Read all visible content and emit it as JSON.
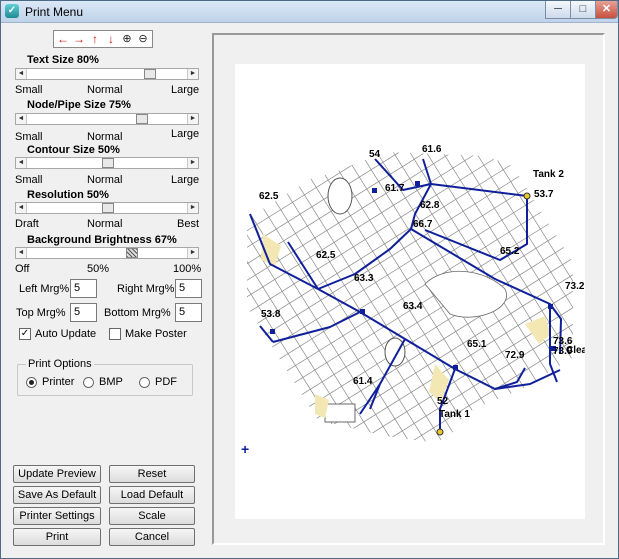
{
  "window": {
    "title": "Print Menu",
    "controls": {
      "minimize": "─",
      "maximize": "□",
      "close": "✕"
    }
  },
  "toolbar": {
    "icons": [
      "arrow-left-icon",
      "arrow-right-icon",
      "arrow-up-icon",
      "arrow-down-icon",
      "zoom-in-icon",
      "zoom-out-icon"
    ]
  },
  "text_size": {
    "label": "Text Size 80%",
    "min": "Small",
    "mid": "Normal",
    "max": "Large",
    "value": 0.8
  },
  "node_size": {
    "label": "Node/Pipe Size 75%",
    "min": "Small",
    "mid": "Normal",
    "max": "Large",
    "value": 0.75
  },
  "contour_size": {
    "label": "Contour Size 50%",
    "min": "Small",
    "mid": "Normal",
    "max": "Large",
    "value": 0.5
  },
  "resolution": {
    "label": "Resolution 50%",
    "min": "Draft",
    "mid": "Normal",
    "max": "Best",
    "value": 0.5
  },
  "background": {
    "label": "Background Brightness 67%",
    "min": "Off",
    "mid": "50%",
    "max": "100%",
    "value": 0.67
  },
  "margins": {
    "left_label": "Left Mrg%",
    "left_value": "5",
    "right_label": "Right Mrg%",
    "right_value": "5",
    "top_label": "Top Mrg%",
    "top_value": "5",
    "bottom_label": "Bottom Mrg%",
    "bottom_value": "5"
  },
  "checks": {
    "auto_update": "Auto Update",
    "auto_update_checked": true,
    "make_poster": "Make Poster",
    "make_poster_checked": false
  },
  "print_options": {
    "label": "Print Options",
    "options": [
      "Printer",
      "BMP",
      "PDF"
    ],
    "selected": "Printer"
  },
  "buttons": {
    "update_preview": "Update Preview",
    "reset": "Reset",
    "save_default": "Save As Default",
    "load_default": "Load Default",
    "printer_settings": "Printer Settings",
    "scale": "Scale",
    "print": "Print",
    "cancel": "Cancel"
  },
  "map": {
    "labels": [
      "54",
      "61.6",
      "Tank 2",
      "62.5",
      "61.7",
      "62.8",
      "53.7",
      "66.7",
      "65.2",
      "62.5",
      "63.3",
      "73.2",
      "63.4",
      "53.8",
      "65.1",
      "72.9",
      "73.6",
      "73.9",
      "Clea",
      "61.4",
      "52",
      "Tank 1"
    ]
  }
}
